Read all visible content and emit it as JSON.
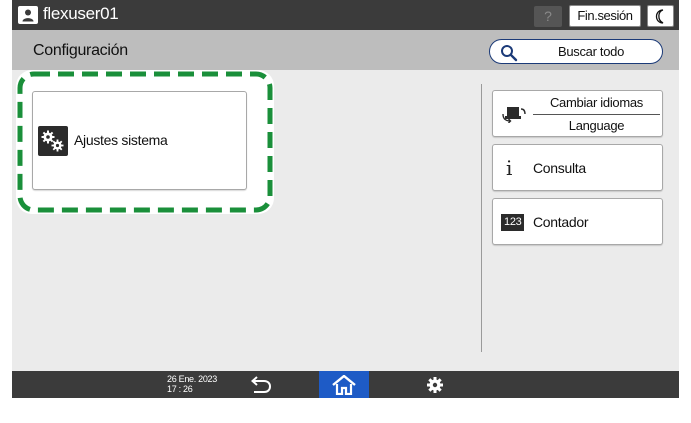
{
  "topbar": {
    "username": "flexuser01",
    "help_label": "?",
    "logout_label": "Fin.sesión"
  },
  "header": {
    "title": "Configuración",
    "search_label": "Buscar todo"
  },
  "tiles": {
    "system_settings": "Ajustes sistema"
  },
  "side_buttons": {
    "language_top": "Cambiar idiomas",
    "language_bottom": "Language",
    "inquiry": "Consulta",
    "counter_icon": "123",
    "counter": "Contador"
  },
  "bottombar": {
    "date": "26 Ene. 2023",
    "time": "17 : 26"
  },
  "colors": {
    "highlight": "#1a8f3a",
    "home_active": "#1e5bc6",
    "bar": "#3b3b3b"
  },
  "icons": [
    "user-icon",
    "moon-icon",
    "search-icon",
    "gears-icon",
    "language-icon",
    "info-icon",
    "counter-icon",
    "back-icon",
    "home-icon",
    "gear-icon"
  ]
}
